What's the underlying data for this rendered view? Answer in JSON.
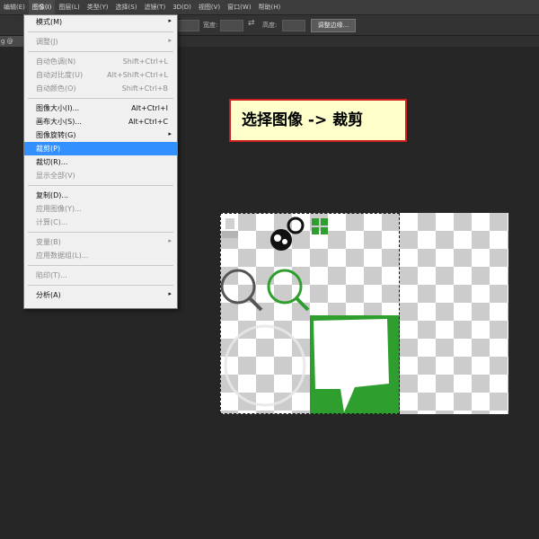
{
  "menubar": {
    "items": [
      {
        "label": "编辑(E)"
      },
      {
        "label": "图像(I)"
      },
      {
        "label": "图层(L)"
      },
      {
        "label": "类型(Y)"
      },
      {
        "label": "选择(S)"
      },
      {
        "label": "滤镜(T)"
      },
      {
        "label": "3D(D)"
      },
      {
        "label": "视图(V)"
      },
      {
        "label": "窗口(W)"
      },
      {
        "label": "帮助(H)"
      }
    ],
    "active_index": 1
  },
  "options_bar": {
    "width_label": "宽度:",
    "height_label": "高度:",
    "refine_edge_button": "调整边缘..."
  },
  "document_tab": {
    "label": "g @ 452%"
  },
  "image_menu": {
    "sections": [
      [
        {
          "label": "模式(M)",
          "submenu": true
        }
      ],
      [
        {
          "label": "调整(J)",
          "submenu": true,
          "disabled": true
        }
      ],
      [
        {
          "label": "自动色调(N)",
          "shortcut": "Shift+Ctrl+L",
          "disabled": true
        },
        {
          "label": "自动对比度(U)",
          "shortcut": "Alt+Shift+Ctrl+L",
          "disabled": true
        },
        {
          "label": "自动颜色(O)",
          "shortcut": "Shift+Ctrl+B",
          "disabled": true
        }
      ],
      [
        {
          "label": "图像大小(I)...",
          "shortcut": "Alt+Ctrl+I"
        },
        {
          "label": "画布大小(S)...",
          "shortcut": "Alt+Ctrl+C"
        },
        {
          "label": "图像旋转(G)",
          "submenu": true
        },
        {
          "label": "裁剪(P)",
          "highlighted": true
        },
        {
          "label": "裁切(R)..."
        },
        {
          "label": "显示全部(V)",
          "disabled": true
        }
      ],
      [
        {
          "label": "复制(D)..."
        },
        {
          "label": "应用图像(Y)...",
          "disabled": true
        },
        {
          "label": "计算(C)...",
          "disabled": true
        }
      ],
      [
        {
          "label": "变量(B)",
          "submenu": true,
          "disabled": true
        },
        {
          "label": "应用数据组(L)...",
          "disabled": true
        }
      ],
      [
        {
          "label": "陷印(T)...",
          "disabled": true
        }
      ],
      [
        {
          "label": "分析(A)",
          "submenu": true
        }
      ]
    ]
  },
  "callout": {
    "text": "选择图像 -> 裁剪"
  },
  "colors": {
    "highlight": "#3390ff",
    "callout_bg": "#ffffcc",
    "callout_border": "#cc2020",
    "icon_green": "#2e9e2e"
  }
}
